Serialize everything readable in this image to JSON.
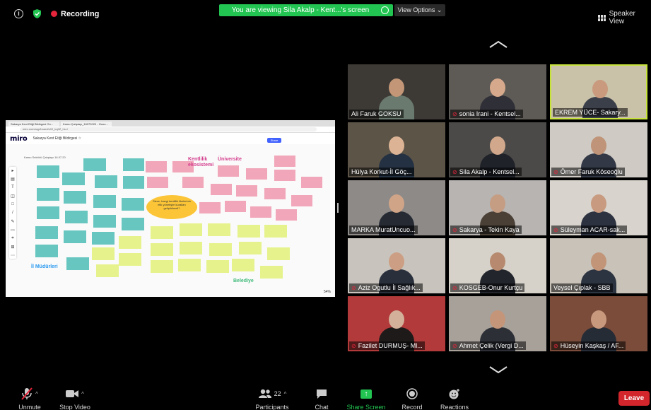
{
  "topbar": {
    "recording_label": "Recording",
    "viewing_banner": "You are viewing Sila Akalp - Kent...'s screen",
    "view_options": "View Options ⌄",
    "speaker_view": "Speaker View"
  },
  "shared_screen": {
    "browser_tabs": [
      "Sakarya Kent Etiği Bildirgesi On...",
      "Kamu Çalıştayı_16072020 - Gooo..."
    ],
    "url": "miro.com/app/board/o9J_kq0Z_hs=/",
    "miro_logo": "miro",
    "board_title": "Sakarya Kent Etiği Bildirgesi ☆",
    "share_label": "Share",
    "canvas_date": "Kamu Sektörü Çalıştayı 16.07.20",
    "labels": {
      "kentlilik": "Kentlilik ekosistemi",
      "universite": "Üniversite",
      "il_mudurleri": "İl Müdürleri",
      "belediye": "Belediye",
      "question": "Sizce, hangi kentlilik ilkelerinin etik yönetişim kuralları geliştirilmeli?"
    },
    "zoom": "54%"
  },
  "participants_grid": [
    {
      "name": "Ali Faruk GOKSU",
      "muted": false,
      "active": false
    },
    {
      "name": "sonia Irani - Kentsel...",
      "muted": true,
      "active": false
    },
    {
      "name": "EKREM YÜCE- Sakary...",
      "muted": false,
      "active": true
    },
    {
      "name": "Hülya Korkut-İl Göç...",
      "muted": false,
      "active": false
    },
    {
      "name": "Sila Akalp - Kentsel...",
      "muted": true,
      "active": false
    },
    {
      "name": "Ömer Faruk Köseoğlu",
      "muted": true,
      "active": false
    },
    {
      "name": "MARKA MuratUncuo...",
      "muted": false,
      "active": false
    },
    {
      "name": "Sakarya - Tekin Kaya",
      "muted": true,
      "active": false
    },
    {
      "name": "Süleyman ACAR-sak...",
      "muted": true,
      "active": false
    },
    {
      "name": "Aziz Ogutlu İl Sağlık...",
      "muted": true,
      "active": false
    },
    {
      "name": "KOSGEB-Onur Kurtçu",
      "muted": true,
      "active": false
    },
    {
      "name": "Veysel Çıplak - SBB",
      "muted": false,
      "active": false
    },
    {
      "name": "Fazilet DURMUŞ- Ml...",
      "muted": true,
      "active": false
    },
    {
      "name": "Ahmet Çelik (Vergi D...",
      "muted": true,
      "active": false
    },
    {
      "name": "Hüseyin Kaşkaş / AF...",
      "muted": true,
      "active": false
    }
  ],
  "controls": {
    "unmute": "Unmute",
    "stop_video": "Stop Video",
    "participants": "Participants",
    "participants_count": "22",
    "chat": "Chat",
    "share_screen": "Share Screen",
    "record": "Record",
    "reactions": "Reactions",
    "leave": "Leave"
  },
  "colors": {
    "green": "#23c552",
    "red": "#e5253b",
    "active_border": "#c7e33b"
  }
}
